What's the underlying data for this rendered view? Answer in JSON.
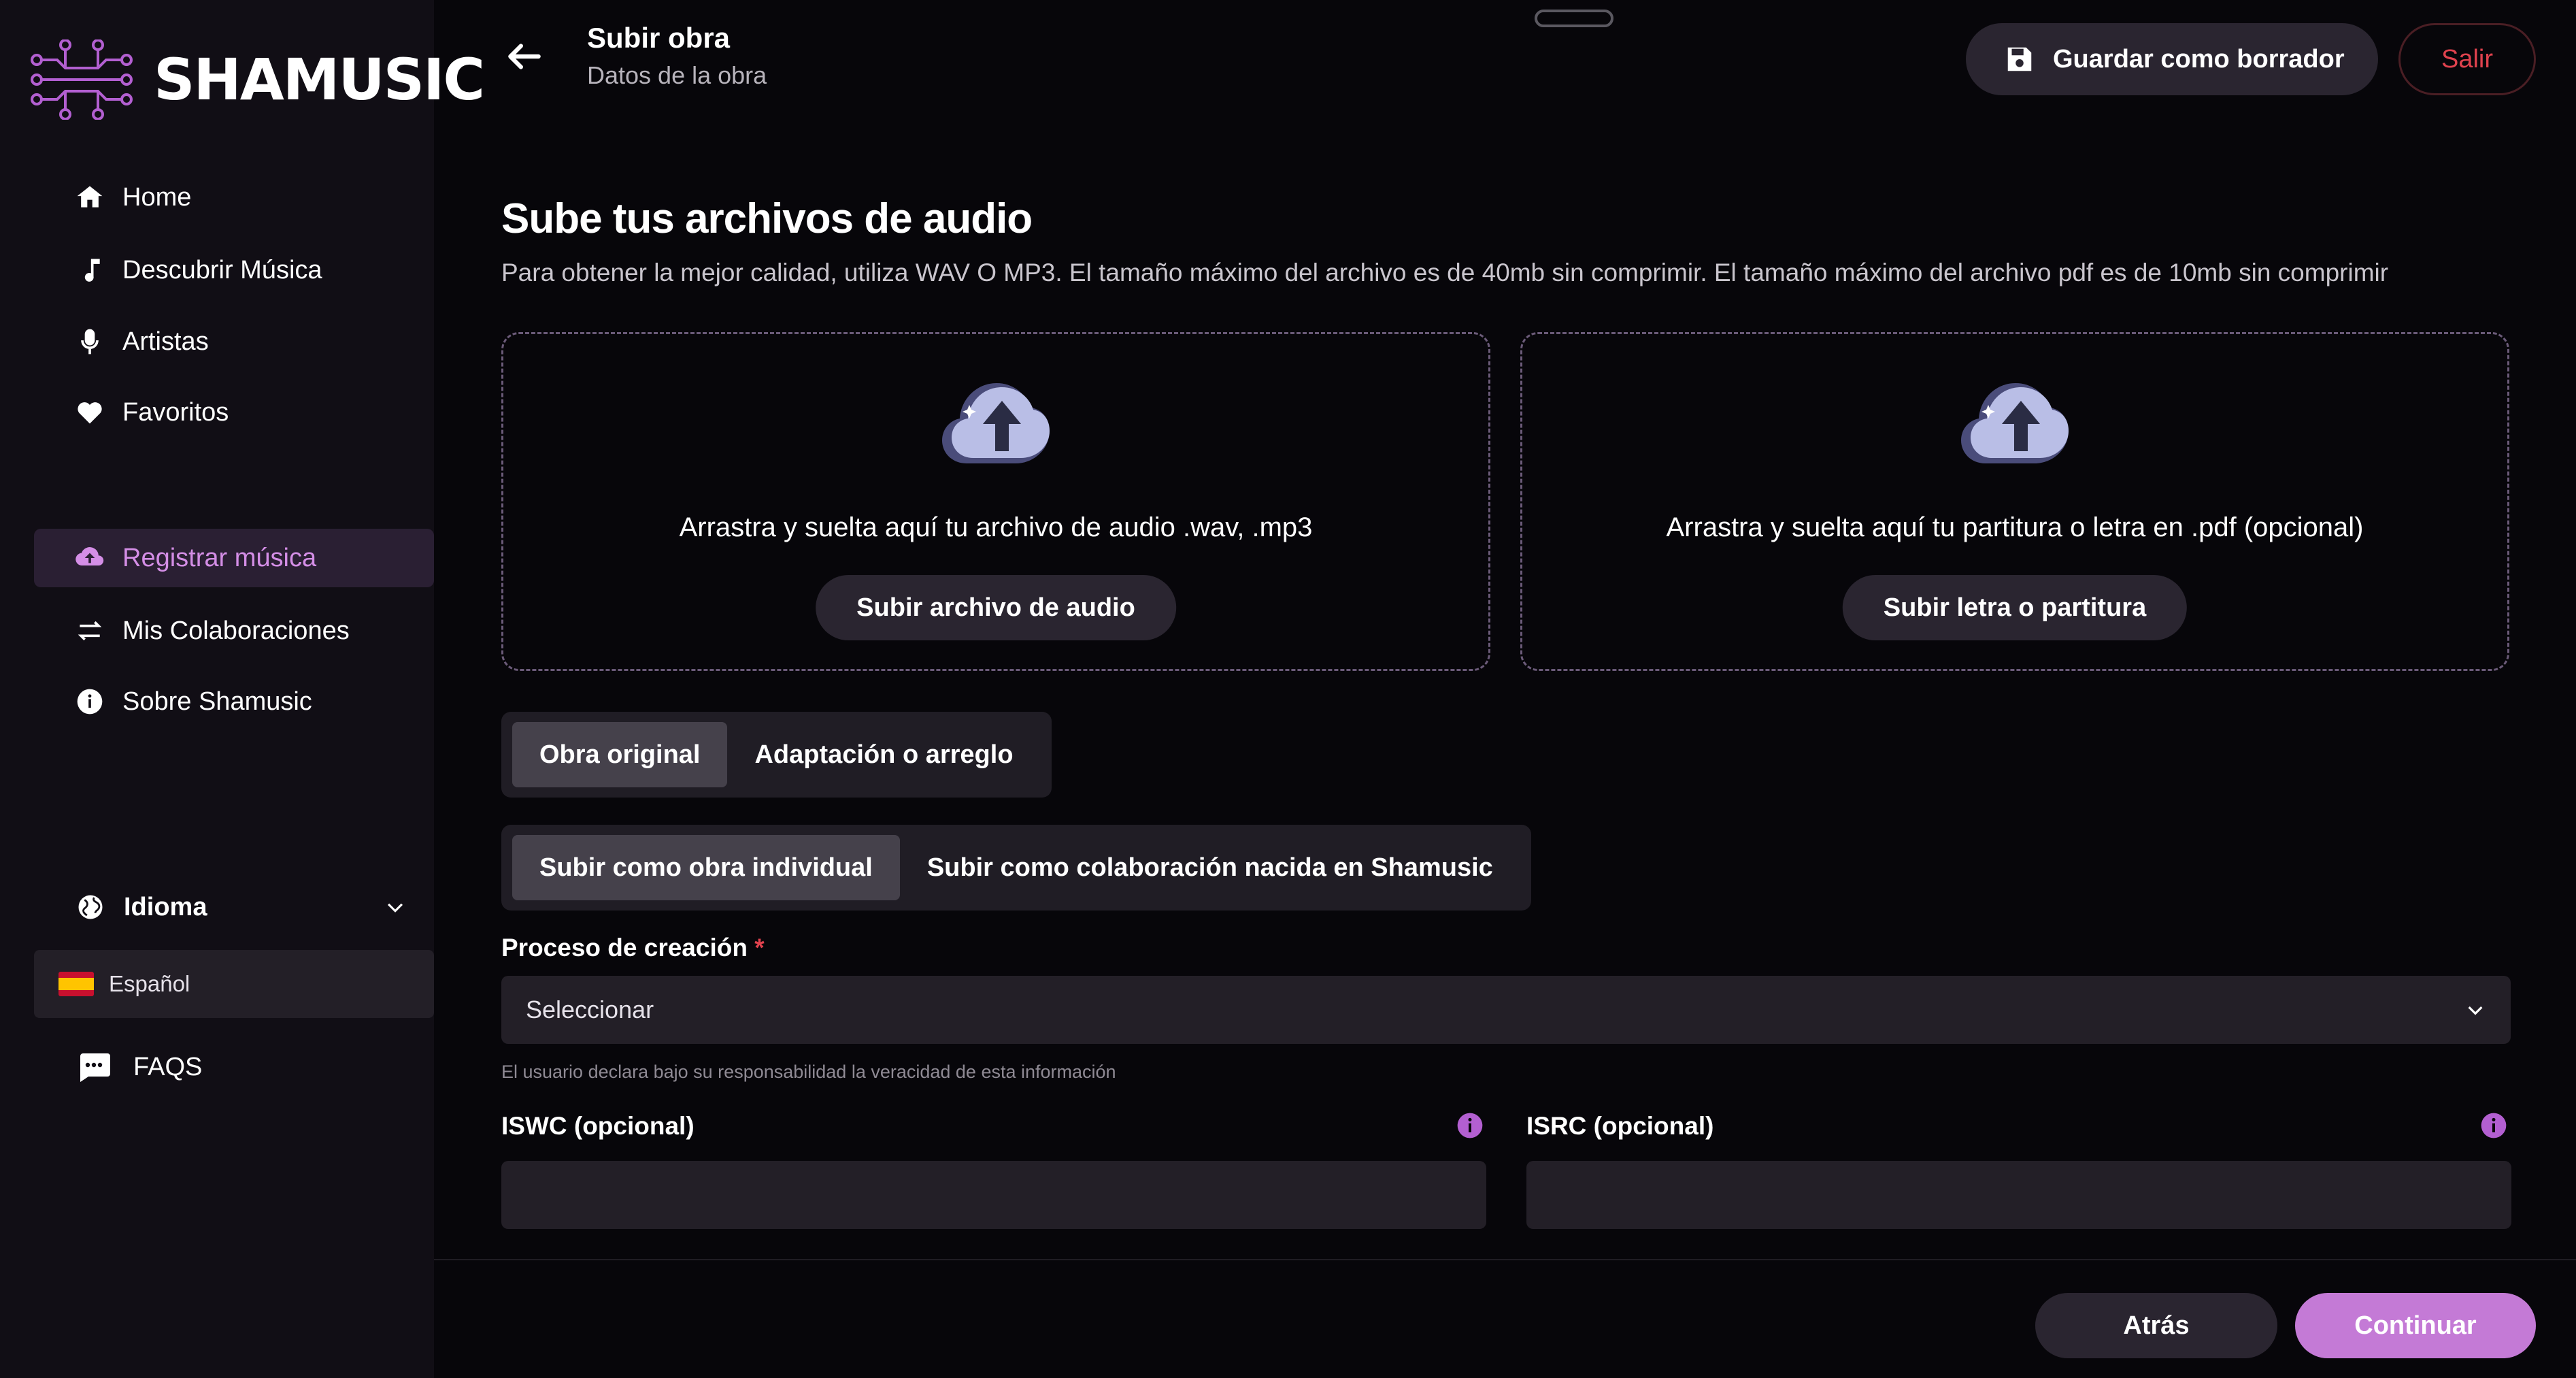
{
  "brand": {
    "name": "SHAMUSIC",
    "accent": "#c47ad6",
    "logo_color": "#b35fd1"
  },
  "sidebar": {
    "nav": [
      {
        "label": "Home",
        "icon": "home-icon"
      },
      {
        "label": "Descubrir Música",
        "icon": "music-note-icon"
      },
      {
        "label": "Artistas",
        "icon": "microphone-icon"
      },
      {
        "label": "Favoritos",
        "icon": "heart-icon"
      }
    ],
    "nav2": [
      {
        "label": "Registrar música",
        "icon": "cloud-upload-icon",
        "active": true
      },
      {
        "label": "Mis Colaboraciones",
        "icon": "swap-icon"
      },
      {
        "label": "Sobre Shamusic",
        "icon": "info-icon"
      }
    ],
    "language": {
      "title": "Idioma",
      "selected": "Español"
    },
    "faqs": "FAQS"
  },
  "header": {
    "title": "Subir obra",
    "subtitle": "Datos de la obra",
    "save_draft": "Guardar como borrador",
    "exit": "Salir"
  },
  "upload": {
    "title": "Sube tus archivos de audio",
    "description": "Para obtener la mejor calidad, utiliza WAV O MP3. El tamaño máximo del archivo es de 40mb sin comprimir. El tamaño máximo del archivo pdf es de 10mb sin comprimir",
    "audio": {
      "text": "Arrastra y suelta aquí tu archivo de audio .wav, .mp3",
      "button": "Subir archivo de audio"
    },
    "pdf": {
      "text": "Arrastra y suelta aquí tu partitura o letra en .pdf (opcional)",
      "button": "Subir letra o partitura"
    }
  },
  "work_type": {
    "options": [
      "Obra original",
      "Adaptación o arreglo"
    ],
    "selected": 0
  },
  "upload_mode": {
    "options": [
      "Subir como obra individual",
      "Subir como colaboración nacida en Shamusic"
    ],
    "selected": 0
  },
  "creation_process": {
    "label": "Proceso de creación",
    "required_mark": "*",
    "value": "Seleccionar",
    "hint": "El usuario declara bajo su responsabilidad la veracidad de esta información"
  },
  "iswc": {
    "label": "ISWC (opcional)",
    "value": ""
  },
  "isrc": {
    "label": "ISRC (opcional)",
    "value": ""
  },
  "footer": {
    "back": "Atrás",
    "continue": "Continuar"
  }
}
